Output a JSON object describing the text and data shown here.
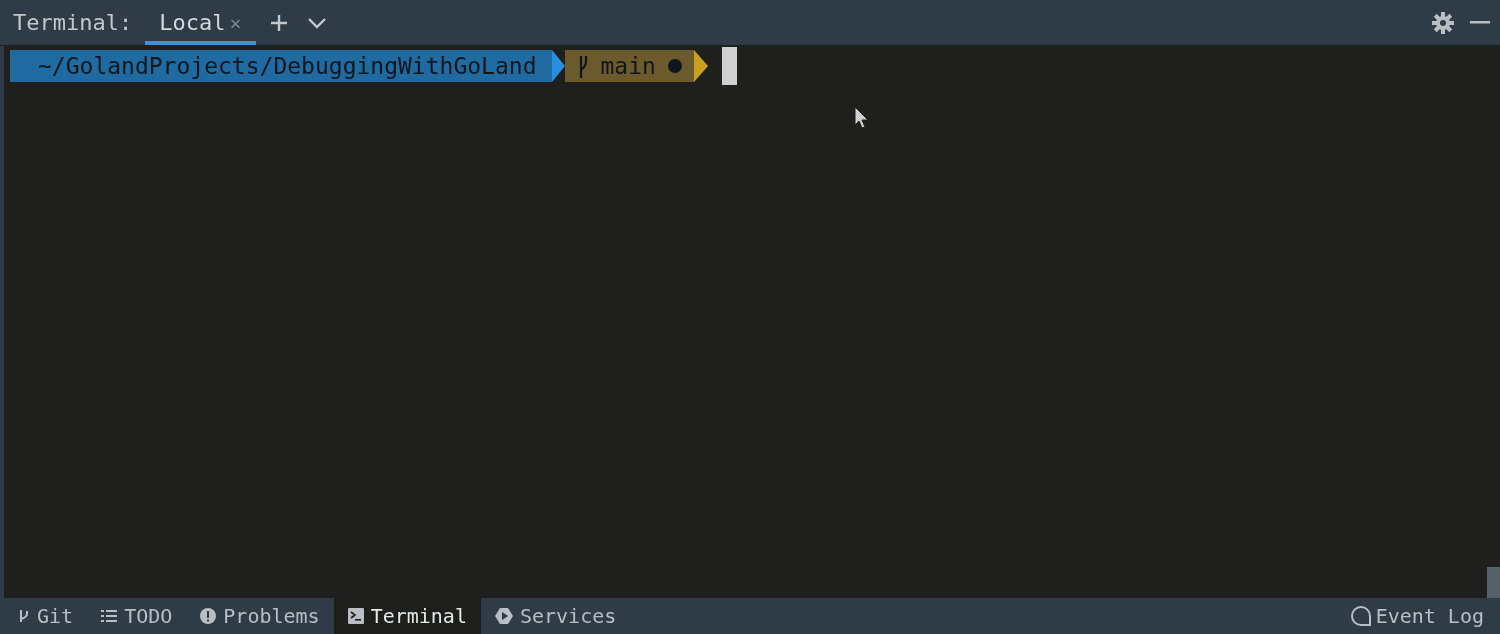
{
  "header": {
    "title": "Terminal:",
    "tabs": [
      {
        "label": "Local",
        "selected": true,
        "close": "×"
      }
    ]
  },
  "prompt": {
    "path": "~/GolandProjects/DebuggingWithGoLand",
    "branch": "main",
    "dirty": true
  },
  "tool_windows": [
    {
      "label": "Git",
      "kind": "git",
      "selected": false
    },
    {
      "label": "TODO",
      "kind": "list",
      "selected": false
    },
    {
      "label": "Problems",
      "kind": "alert",
      "selected": false
    },
    {
      "label": "Terminal",
      "kind": "terminal",
      "selected": true
    },
    {
      "label": "Services",
      "kind": "play",
      "selected": false
    }
  ],
  "event_log": {
    "label": "Event Log"
  }
}
